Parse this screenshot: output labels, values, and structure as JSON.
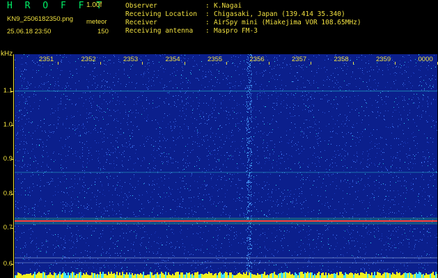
{
  "header": {
    "app_title": "H R O F F T",
    "version": "1.00f",
    "filename": "KN9_2506182350.png",
    "mode": "meteor",
    "datetime": "25.06.18 23:50",
    "count": "150"
  },
  "info": [
    {
      "label": "Observer",
      "value": "K.Nagai"
    },
    {
      "label": "Receiving Location",
      "value": "Chigasaki, Japan (139.414 35.340)"
    },
    {
      "label": "Receiver",
      "value": "AirSpy mini (Miakejima VOR 108.65MHz)"
    },
    {
      "label": "Receiving antenna",
      "value": "Maspro FM-3"
    }
  ],
  "axis": {
    "y_unit": "kHz",
    "y_ticks": [
      "1.1",
      "1.0",
      "0.9",
      "0.8",
      "0.7",
      "0.6"
    ],
    "x_ticks": [
      "2351",
      "2352",
      "2353",
      "2354",
      "2355",
      "2356",
      "2357",
      "2358",
      "2359",
      "0000"
    ]
  },
  "colors": {
    "background": "#0b1f8c",
    "label": "#f0e040",
    "title": "#00ee66",
    "signal": "#ff3b3b"
  }
}
